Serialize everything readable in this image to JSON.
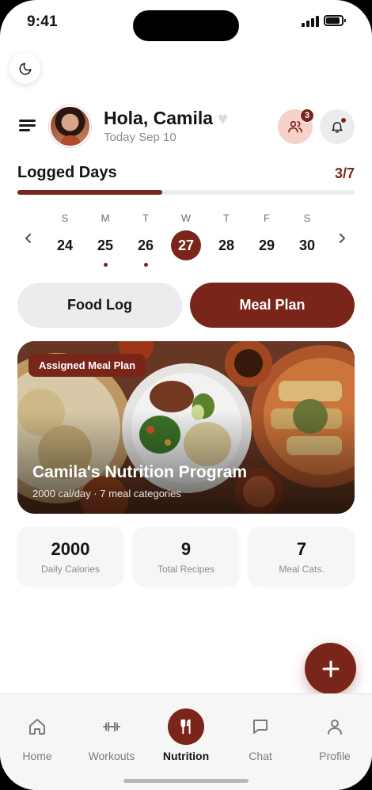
{
  "status_bar": {
    "time": "9:41"
  },
  "header": {
    "greeting": "Hola, Camila",
    "date": "Today Sep 10",
    "friends_badge": "3"
  },
  "logged_days": {
    "title": "Logged Days",
    "count": "3/7",
    "progress": 0.43
  },
  "week": {
    "days": [
      {
        "letter": "S",
        "num": "24",
        "logged": false,
        "selected": false
      },
      {
        "letter": "M",
        "num": "25",
        "logged": true,
        "selected": false
      },
      {
        "letter": "T",
        "num": "26",
        "logged": true,
        "selected": false
      },
      {
        "letter": "W",
        "num": "27",
        "logged": false,
        "selected": true
      },
      {
        "letter": "T",
        "num": "28",
        "logged": false,
        "selected": false
      },
      {
        "letter": "F",
        "num": "29",
        "logged": false,
        "selected": false
      },
      {
        "letter": "S",
        "num": "30",
        "logged": false,
        "selected": false
      }
    ]
  },
  "tabs": {
    "food_log": "Food Log",
    "meal_plan": "Meal Plan",
    "active": "meal_plan"
  },
  "hero": {
    "tag": "Assigned Meal Plan",
    "title": "Camila's Nutrition Program",
    "subtitle": "2000 cal/day · 7 meal categories"
  },
  "stats": [
    {
      "value": "2000",
      "label": "Daily Calories"
    },
    {
      "value": "9",
      "label": "Total Recipes"
    },
    {
      "value": "7",
      "label": "Meal Cats."
    }
  ],
  "nav": [
    {
      "label": "Home",
      "icon": "home-icon"
    },
    {
      "label": "Workouts",
      "icon": "dumbbell-icon"
    },
    {
      "label": "Nutrition",
      "icon": "fork-knife-icon"
    },
    {
      "label": "Chat",
      "icon": "chat-icon"
    },
    {
      "label": "Profile",
      "icon": "person-icon"
    }
  ],
  "nav_active": "Nutrition",
  "colors": {
    "accent": "#7a2519",
    "accent_soft": "#f7d2cb",
    "surface": "#ececef"
  }
}
